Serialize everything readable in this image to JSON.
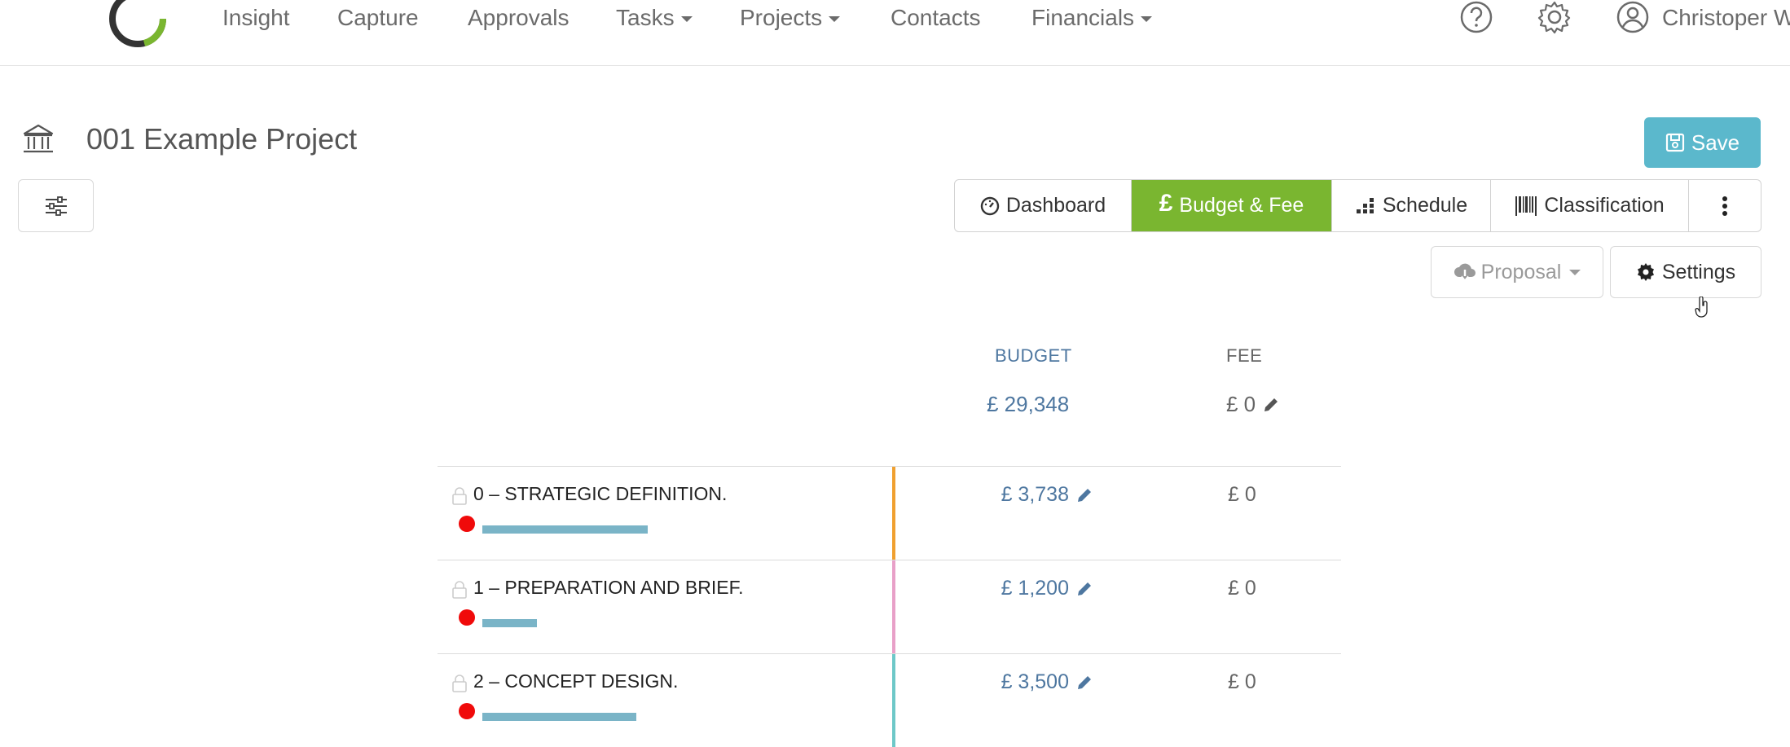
{
  "nav": {
    "items": [
      {
        "label": "Insight",
        "dropdown": false
      },
      {
        "label": "Capture",
        "dropdown": false
      },
      {
        "label": "Approvals",
        "dropdown": false
      },
      {
        "label": "Tasks",
        "dropdown": true
      },
      {
        "label": "Projects",
        "dropdown": true
      },
      {
        "label": "Contacts",
        "dropdown": false
      },
      {
        "label": "Financials",
        "dropdown": true
      }
    ],
    "user_name": "Christoper W",
    "icons": [
      "help-icon",
      "gear-icon",
      "user-avatar-icon"
    ]
  },
  "header": {
    "project_title": "001 Example Project",
    "save_label": "Save"
  },
  "tabs": [
    {
      "label": "Dashboard",
      "icon": "dashboard-icon",
      "active": false
    },
    {
      "label": "Budget & Fee",
      "icon": "pound-icon",
      "active": true
    },
    {
      "label": "Schedule",
      "icon": "schedule-icon",
      "active": false
    },
    {
      "label": "Classification",
      "icon": "barcode-icon",
      "active": false
    }
  ],
  "actions": {
    "proposal_label": "Proposal",
    "settings_label": "Settings"
  },
  "columns": {
    "budget_header": "BUDGET",
    "fee_header": "FEE",
    "budget_total": "£ 29,348",
    "fee_total": "£ 0"
  },
  "stages": [
    {
      "name": "0 – STRATEGIC DEFINITION.",
      "budget": "£ 3,738",
      "fee": "£ 0",
      "progress": 0.28,
      "color": "#f0a030"
    },
    {
      "name": "1 – PREPARATION AND BRIEF.",
      "budget": "£ 1,200",
      "fee": "£ 0",
      "progress": 0.09,
      "color": "#e8a0c8"
    },
    {
      "name": "2 – CONCEPT DESIGN.",
      "budget": "£ 3,500",
      "fee": "£ 0",
      "progress": 0.26,
      "color": "#6ec8c8"
    }
  ],
  "colors": {
    "accent_green": "#7ab630",
    "save_blue": "#5bb8cc",
    "link_blue": "#4e77a0",
    "status_red": "#f00a0a"
  }
}
